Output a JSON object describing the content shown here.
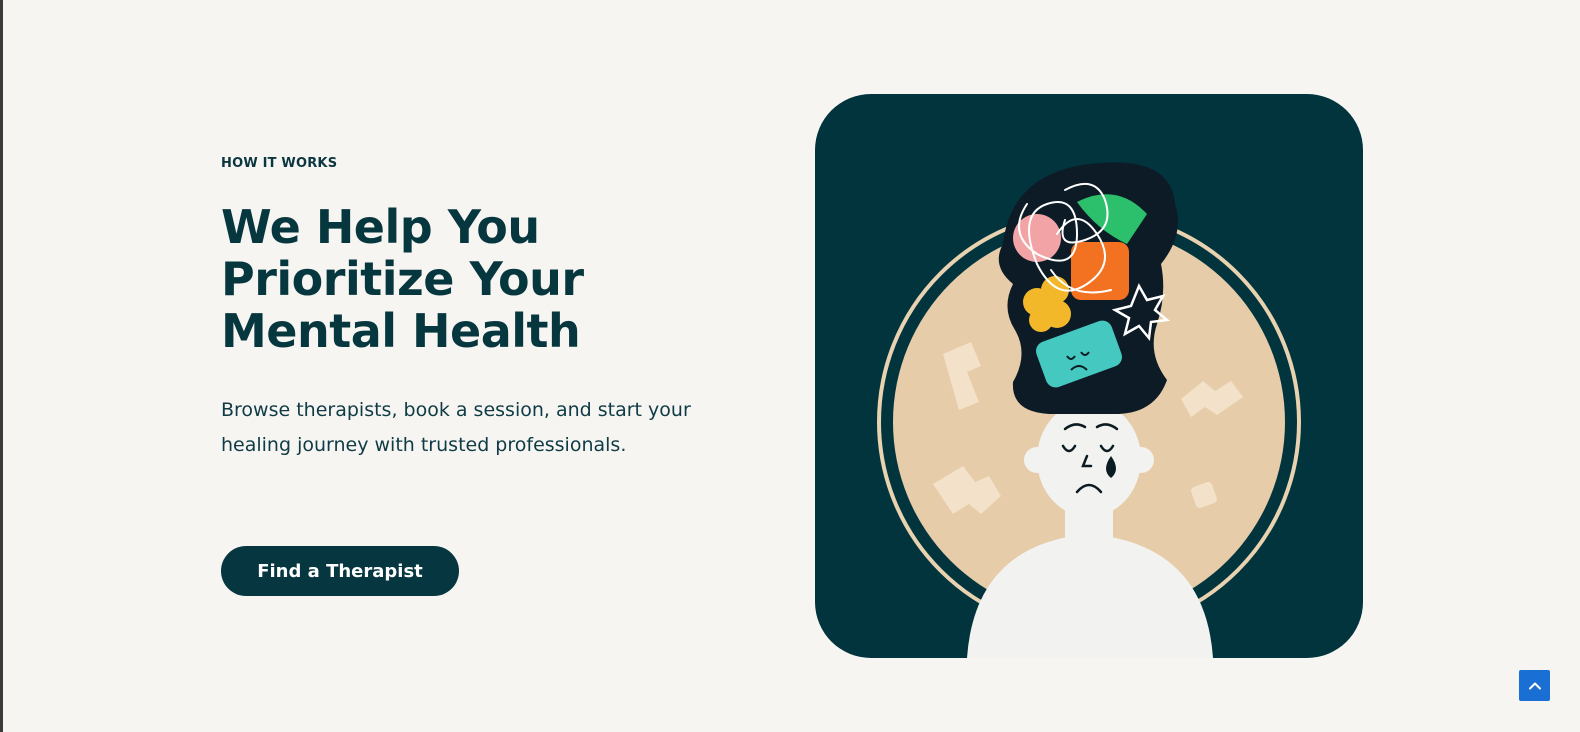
{
  "hero": {
    "eyebrow": "HOW IT WORKS",
    "headline_lines": [
      "We Help You",
      "Prioritize Your",
      "Mental Health"
    ],
    "description": "Browse therapists, book a session, and start your healing journey with trusted professionals.",
    "cta_label": "Find a Therapist"
  },
  "colors": {
    "brand_dark": "#06363f",
    "background": "#f7f5f2",
    "scroll_button": "#1a6fd4"
  },
  "icons": {
    "scroll_top": "chevron-up-icon"
  }
}
